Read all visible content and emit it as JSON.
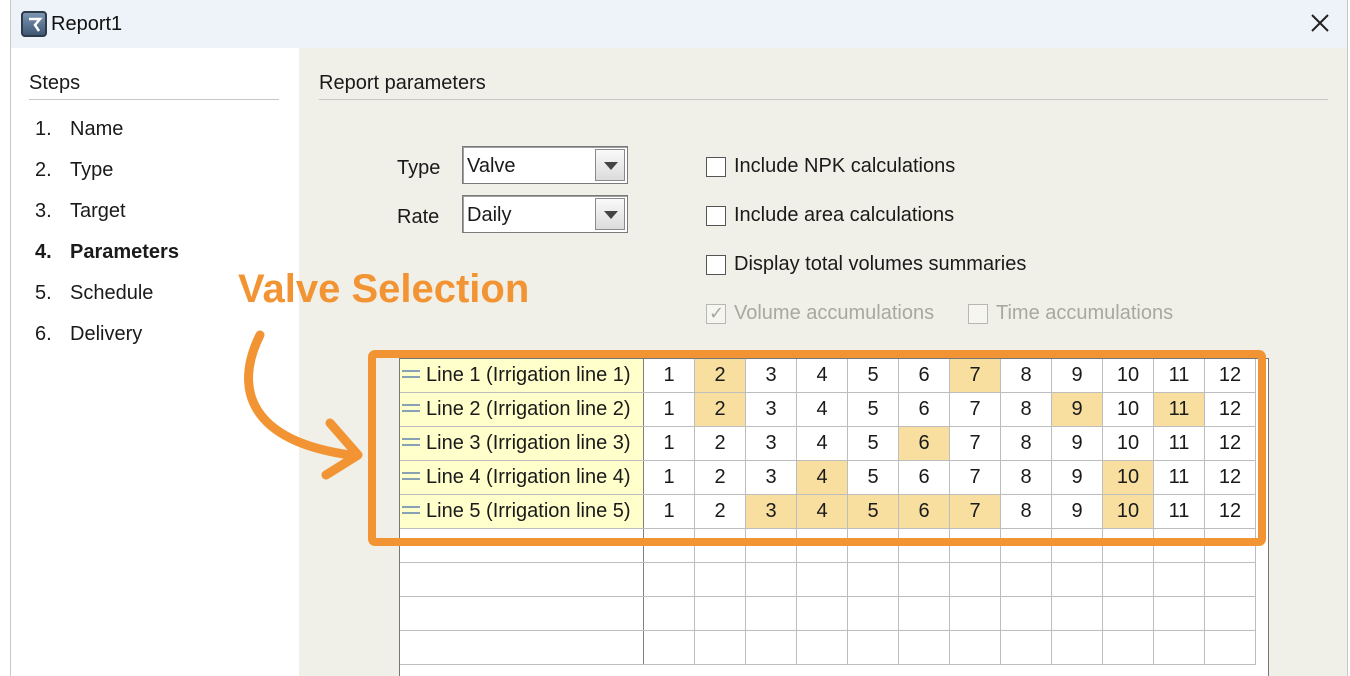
{
  "window": {
    "title": "Report1"
  },
  "steps": {
    "title": "Steps",
    "items": [
      {
        "num": "1.",
        "label": "Name",
        "active": false
      },
      {
        "num": "2.",
        "label": "Type",
        "active": false
      },
      {
        "num": "3.",
        "label": "Target",
        "active": false
      },
      {
        "num": "4.",
        "label": "Parameters",
        "active": true
      },
      {
        "num": "5.",
        "label": "Schedule",
        "active": false
      },
      {
        "num": "6.",
        "label": "Delivery",
        "active": false
      }
    ]
  },
  "params": {
    "title": "Report parameters",
    "type_label": "Type",
    "type_value": "Valve",
    "rate_label": "Rate",
    "rate_value": "Daily",
    "checks": [
      {
        "label": "Include NPK calculations",
        "checked": false,
        "disabled": false
      },
      {
        "label": "Include area calculations",
        "checked": false,
        "disabled": false
      },
      {
        "label": "Display total volumes summaries",
        "checked": false,
        "disabled": false
      },
      {
        "label": "Volume accumulations",
        "checked": true,
        "disabled": true
      },
      {
        "label": "Time accumulations",
        "checked": false,
        "disabled": true
      }
    ]
  },
  "grid": {
    "columns": [
      "1",
      "2",
      "3",
      "4",
      "5",
      "6",
      "7",
      "8",
      "9",
      "10",
      "11",
      "12"
    ],
    "rows": [
      {
        "name": "Line 1 (Irrigation line 1)",
        "selected": [
          "2",
          "7"
        ]
      },
      {
        "name": "Line 2 (Irrigation line 2)",
        "selected": [
          "2",
          "9",
          "11"
        ]
      },
      {
        "name": "Line 3 (Irrigation line 3)",
        "selected": [
          "6"
        ]
      },
      {
        "name": "Line 4 (Irrigation line 4)",
        "selected": [
          "4",
          "10"
        ]
      },
      {
        "name": "Line 5 (Irrigation line 5)",
        "selected": [
          "3",
          "4",
          "5",
          "6",
          "7",
          "10"
        ]
      }
    ]
  },
  "annotation": {
    "text": "Valve Selection",
    "color": "#f29433"
  },
  "colors": {
    "selected_cell": "#f8dfa0",
    "line_name_bg": "#ffffcc"
  }
}
